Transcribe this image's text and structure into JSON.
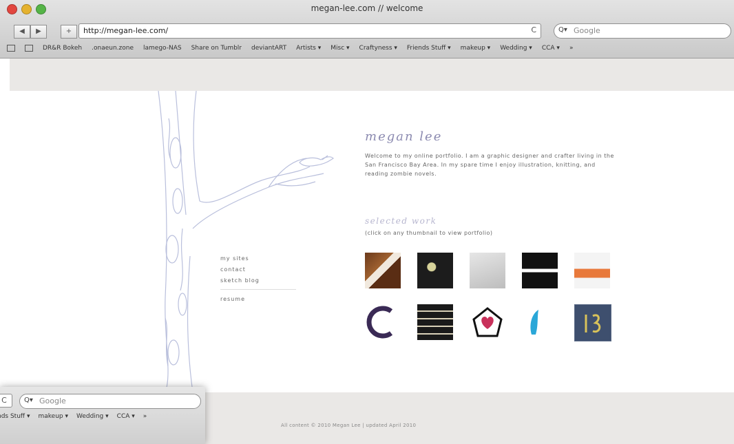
{
  "window": {
    "title": "megan-lee.com // welcome"
  },
  "toolbar": {
    "back_label": "◀",
    "forward_label": "▶",
    "add_label": "+",
    "url": "http://megan-lee.com/",
    "reload_label": "C",
    "search_placeholder": "Google",
    "search_icon": "Q▾"
  },
  "bookmarks": [
    "DR&R Bokeh",
    ".onaeun.zone",
    "lamego-NAS",
    "Share on Tumblr",
    "deviantART",
    "Artists ▾",
    "Misc ▾",
    "Craftyness ▾",
    "Friends Stuff ▾",
    "makeup ▾",
    "Wedding ▾",
    "CCA ▾",
    "»"
  ],
  "page": {
    "name": "megan lee",
    "intro": "Welcome to my online portfolio. I am a graphic designer and crafter living in the San Francisco Bay Area. In my spare time I enjoy illustration, knitting, and reading zombie novels.",
    "selected_title": "selected work",
    "selected_sub": "(click on any thumbnail to view portfolio)",
    "nav": [
      "my sites",
      "contact",
      "sketch blog",
      "resume"
    ],
    "footer": "All content © 2010 Megan Lee | updated April 2010"
  },
  "inset": {
    "reload_label": "C",
    "search_placeholder": "Google",
    "bookmarks": [
      "nds Stuff ▾",
      "makeup ▾",
      "Wedding ▾",
      "CCA ▾",
      "»"
    ]
  },
  "colors": {
    "tree_stroke": "#b9bfdc",
    "accent_heading": "#8b8ab0",
    "chrome": "#d4d4d4",
    "page_band": "#eae8e6"
  }
}
